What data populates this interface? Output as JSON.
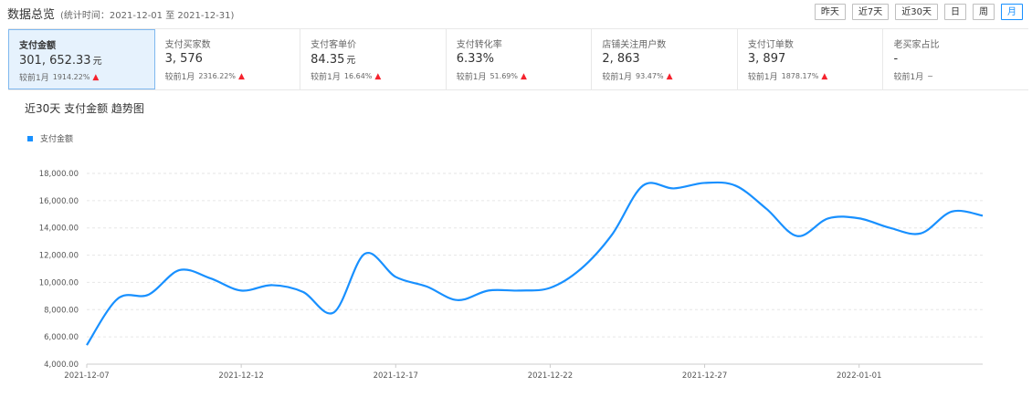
{
  "header": {
    "title": "数据总览",
    "period": "(统计时间：2021-12-01 至 2021-12-31)"
  },
  "range_buttons": [
    {
      "label": "昨天",
      "active": false
    },
    {
      "label": "近7天",
      "active": false
    },
    {
      "label": "近30天",
      "active": false
    },
    {
      "label": "日",
      "active": false
    },
    {
      "label": "周",
      "active": false
    },
    {
      "label": "月",
      "active": true
    }
  ],
  "metrics": [
    {
      "name": "支付金额",
      "value": "301, 652.33",
      "unit": "元",
      "compare": "较前1月",
      "pct": "1914.22%",
      "arrow": "up"
    },
    {
      "name": "支付买家数",
      "value": "3, 576",
      "unit": "",
      "compare": "较前1月",
      "pct": "2316.22%",
      "arrow": "up"
    },
    {
      "name": "支付客单价",
      "value": "84.35",
      "unit": "元",
      "compare": "较前1月",
      "pct": "16.64%",
      "arrow": "up"
    },
    {
      "name": "支付转化率",
      "value": "6.33%",
      "unit": "",
      "compare": "较前1月",
      "pct": "51.69%",
      "arrow": "up"
    },
    {
      "name": "店铺关注用户数",
      "value": "2, 863",
      "unit": "",
      "compare": "较前1月",
      "pct": "93.47%",
      "arrow": "up"
    },
    {
      "name": "支付订单数",
      "value": "3, 897",
      "unit": "",
      "compare": "较前1月",
      "pct": "1878.17%",
      "arrow": "up"
    },
    {
      "name": "老买家占比",
      "value": "-",
      "unit": "",
      "compare": "较前1月",
      "pct": "",
      "arrow": "~"
    }
  ],
  "colors": {
    "accent": "#1890ff",
    "up_arrow": "#f5222d",
    "selected_bg": "#e6f2fd"
  },
  "chart_data": {
    "type": "line",
    "title": "近30天 支付金额 趋势图",
    "legend": "top-left",
    "grid": "horizontal dashed",
    "series": [
      {
        "name": "支付金额",
        "color": "#1890ff",
        "x": [
          "2021-12-07",
          "2021-12-08",
          "2021-12-09",
          "2021-12-10",
          "2021-12-11",
          "2021-12-12",
          "2021-12-13",
          "2021-12-14",
          "2021-12-15",
          "2021-12-16",
          "2021-12-17",
          "2021-12-18",
          "2021-12-19",
          "2021-12-20",
          "2021-12-21",
          "2021-12-22",
          "2021-12-23",
          "2021-12-24",
          "2021-12-25",
          "2021-12-26",
          "2021-12-27",
          "2021-12-28",
          "2021-12-29",
          "2021-12-30",
          "2021-12-31",
          "2022-01-01",
          "2022-01-02",
          "2022-01-03",
          "2022-01-04",
          "2022-01-05"
        ],
        "values": [
          5400,
          8800,
          9100,
          10900,
          10300,
          9400,
          9800,
          9300,
          7800,
          12100,
          10400,
          9700,
          8700,
          9400,
          9400,
          9600,
          11000,
          13500,
          17100,
          16900,
          17300,
          17100,
          15400,
          13400,
          14700,
          14700,
          14000,
          13600,
          15200,
          14900
        ]
      }
    ],
    "x_tick_labels": [
      "2021-12-07",
      "2021-12-12",
      "2021-12-17",
      "2021-12-22",
      "2021-12-27",
      "2022-01-01"
    ],
    "y_ticks": [
      4000,
      6000,
      8000,
      10000,
      12000,
      14000,
      16000,
      18000
    ],
    "y_tick_labels": [
      "4,000.00",
      "6,000.00",
      "8,000.00",
      "10,000.00",
      "12,000.00",
      "14,000.00",
      "16,000.00",
      "18,000.00"
    ],
    "ylim": [
      4000,
      18000
    ]
  }
}
